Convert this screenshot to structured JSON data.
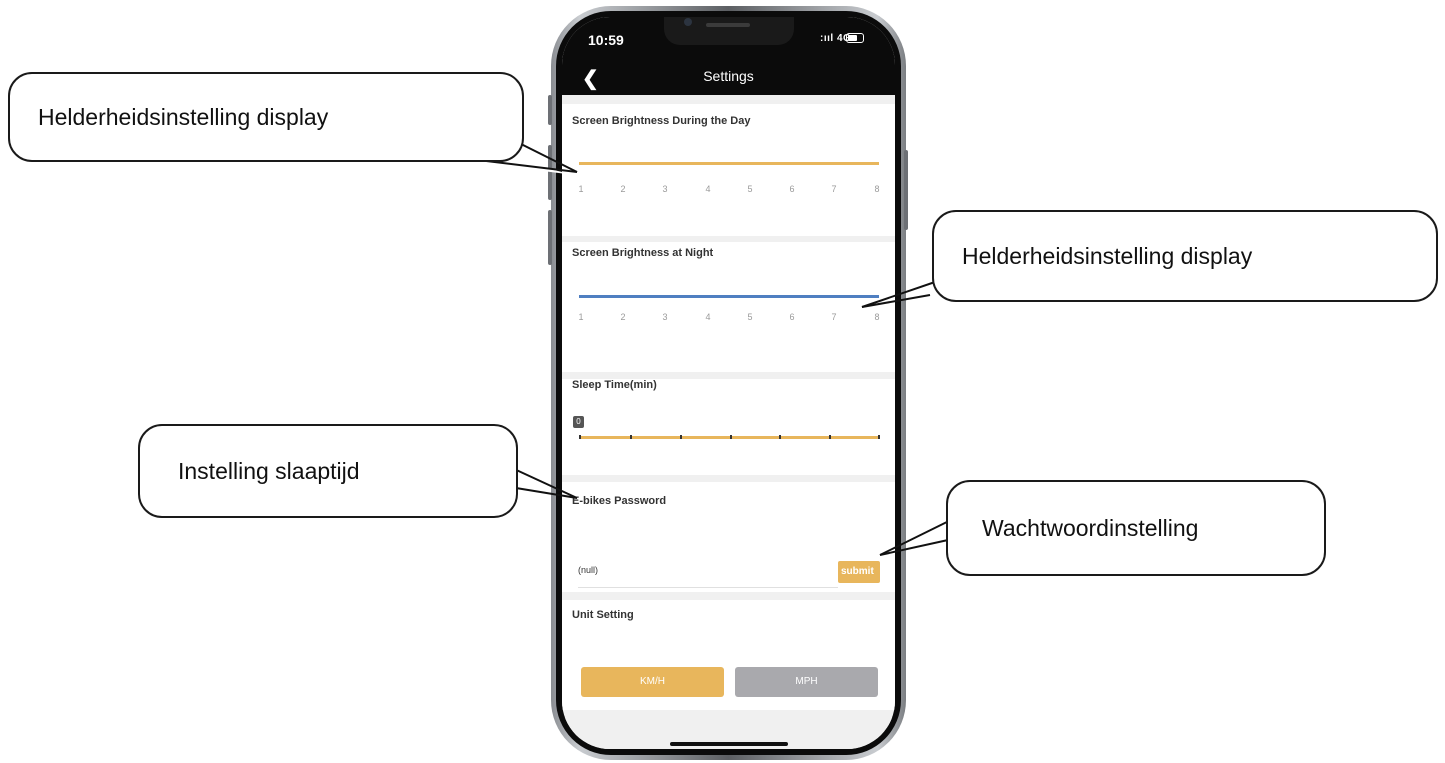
{
  "statusbar": {
    "time": "10:59",
    "network": ":ııl 4G"
  },
  "navbar": {
    "back_icon": "chevron-left-icon",
    "title": "Settings"
  },
  "day_brightness": {
    "title": "Screen Brightness During the Day",
    "ticks": [
      "1",
      "2",
      "3",
      "4",
      "5",
      "6",
      "7",
      "8"
    ],
    "color": "#e8b65c"
  },
  "night_brightness": {
    "title": "Screen Brightness at Night",
    "ticks": [
      "1",
      "2",
      "3",
      "4",
      "5",
      "6",
      "7",
      "8"
    ],
    "color": "#4f7fc1"
  },
  "sleep_time": {
    "title": "Sleep Time(min)",
    "value": "0"
  },
  "password": {
    "title": "E-bikes Password",
    "value": "(null)",
    "submit_label": "submit"
  },
  "unit": {
    "title": "Unit Setting",
    "kmh_label": "KM/H",
    "mph_label": "MPH",
    "selected_color": "#e8b65c",
    "unselected_color": "#a9a9ad"
  },
  "callouts": {
    "day": "Helderheidsinstelling display",
    "night": "Helderheidsinstelling display",
    "sleep": "Instelling slaaptijd",
    "password": "Wachtwoordinstelling"
  }
}
